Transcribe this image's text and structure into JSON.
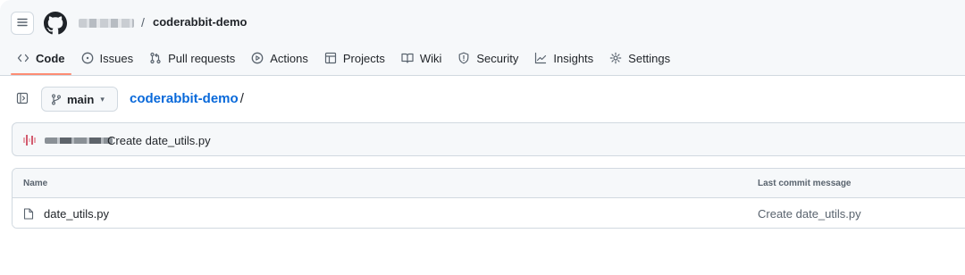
{
  "header": {
    "repo_name": "coderabbit-demo",
    "separator": "/"
  },
  "tabs": [
    {
      "label": "Code",
      "icon": "code-icon",
      "active": true
    },
    {
      "label": "Issues",
      "icon": "issue-circle-icon",
      "active": false
    },
    {
      "label": "Pull requests",
      "icon": "pull-request-icon",
      "active": false
    },
    {
      "label": "Actions",
      "icon": "play-circle-icon",
      "active": false
    },
    {
      "label": "Projects",
      "icon": "table-icon",
      "active": false
    },
    {
      "label": "Wiki",
      "icon": "book-icon",
      "active": false
    },
    {
      "label": "Security",
      "icon": "shield-icon",
      "active": false
    },
    {
      "label": "Insights",
      "icon": "graph-icon",
      "active": false
    },
    {
      "label": "Settings",
      "icon": "gear-icon",
      "active": false
    }
  ],
  "branch": {
    "name": "main",
    "caret": "▾"
  },
  "path": {
    "repo_link": "coderabbit-demo",
    "trailing_slash": "/"
  },
  "latest_commit": {
    "message": "Create date_utils.py"
  },
  "file_table": {
    "columns": [
      "Name",
      "Last commit message"
    ],
    "rows": [
      {
        "name": "date_utils.py",
        "commit_message": "Create date_utils.py",
        "icon": "file-icon"
      }
    ]
  },
  "colors": {
    "accent_underline": "#fd8c73",
    "link": "#0969da",
    "border": "#d1d9e0",
    "header_bg": "#f6f8fa"
  }
}
